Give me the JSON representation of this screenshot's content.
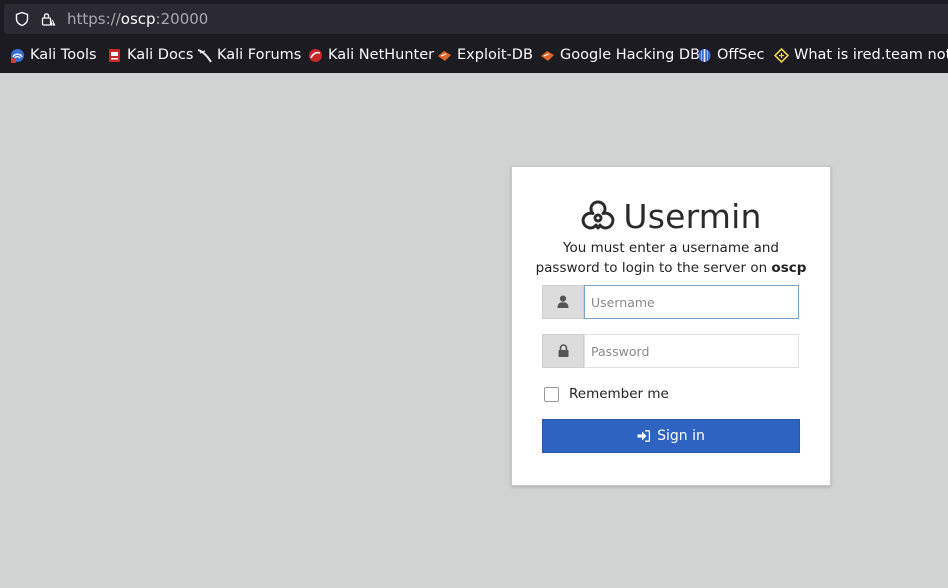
{
  "browser": {
    "url_scheme": "https://",
    "url_host": "oscp",
    "url_port": ":20000",
    "icons": [
      "shield-icon",
      "lock-warning-icon"
    ],
    "bookmarks": [
      {
        "label": "Kali Tools",
        "icon": "kali-tools-icon"
      },
      {
        "label": "Kali Docs",
        "icon": "kali-docs-icon"
      },
      {
        "label": "Kali Forums",
        "icon": "kali-forums-icon"
      },
      {
        "label": "Kali NetHunter",
        "icon": "kali-nethunter-icon"
      },
      {
        "label": "Exploit-DB",
        "icon": "exploit-db-icon"
      },
      {
        "label": "Google Hacking DB",
        "icon": "ghdb-icon"
      },
      {
        "label": "OffSec",
        "icon": "offsec-icon"
      },
      {
        "label": "What is ired.team note...",
        "icon": "ired-team-icon"
      }
    ]
  },
  "login": {
    "brand_title": "Usermin",
    "brand_icon": "usermin-logo-icon",
    "subtitle_prefix": "You must enter a username and password to login to the server on ",
    "server_name": "oscp",
    "username_placeholder": "Username",
    "username_icon": "user-icon",
    "password_placeholder": "Password",
    "password_icon": "lock-icon",
    "remember_label": "Remember me",
    "signin_label": "Sign in",
    "signin_icon": "sign-in-icon"
  },
  "colors": {
    "page_background": "#d1d3d3",
    "chrome_background": "#1c1b22",
    "url_bar_background": "#2b2a33",
    "signin_button": "#2f63c2",
    "focused_input_border": "#7aa5c8"
  }
}
